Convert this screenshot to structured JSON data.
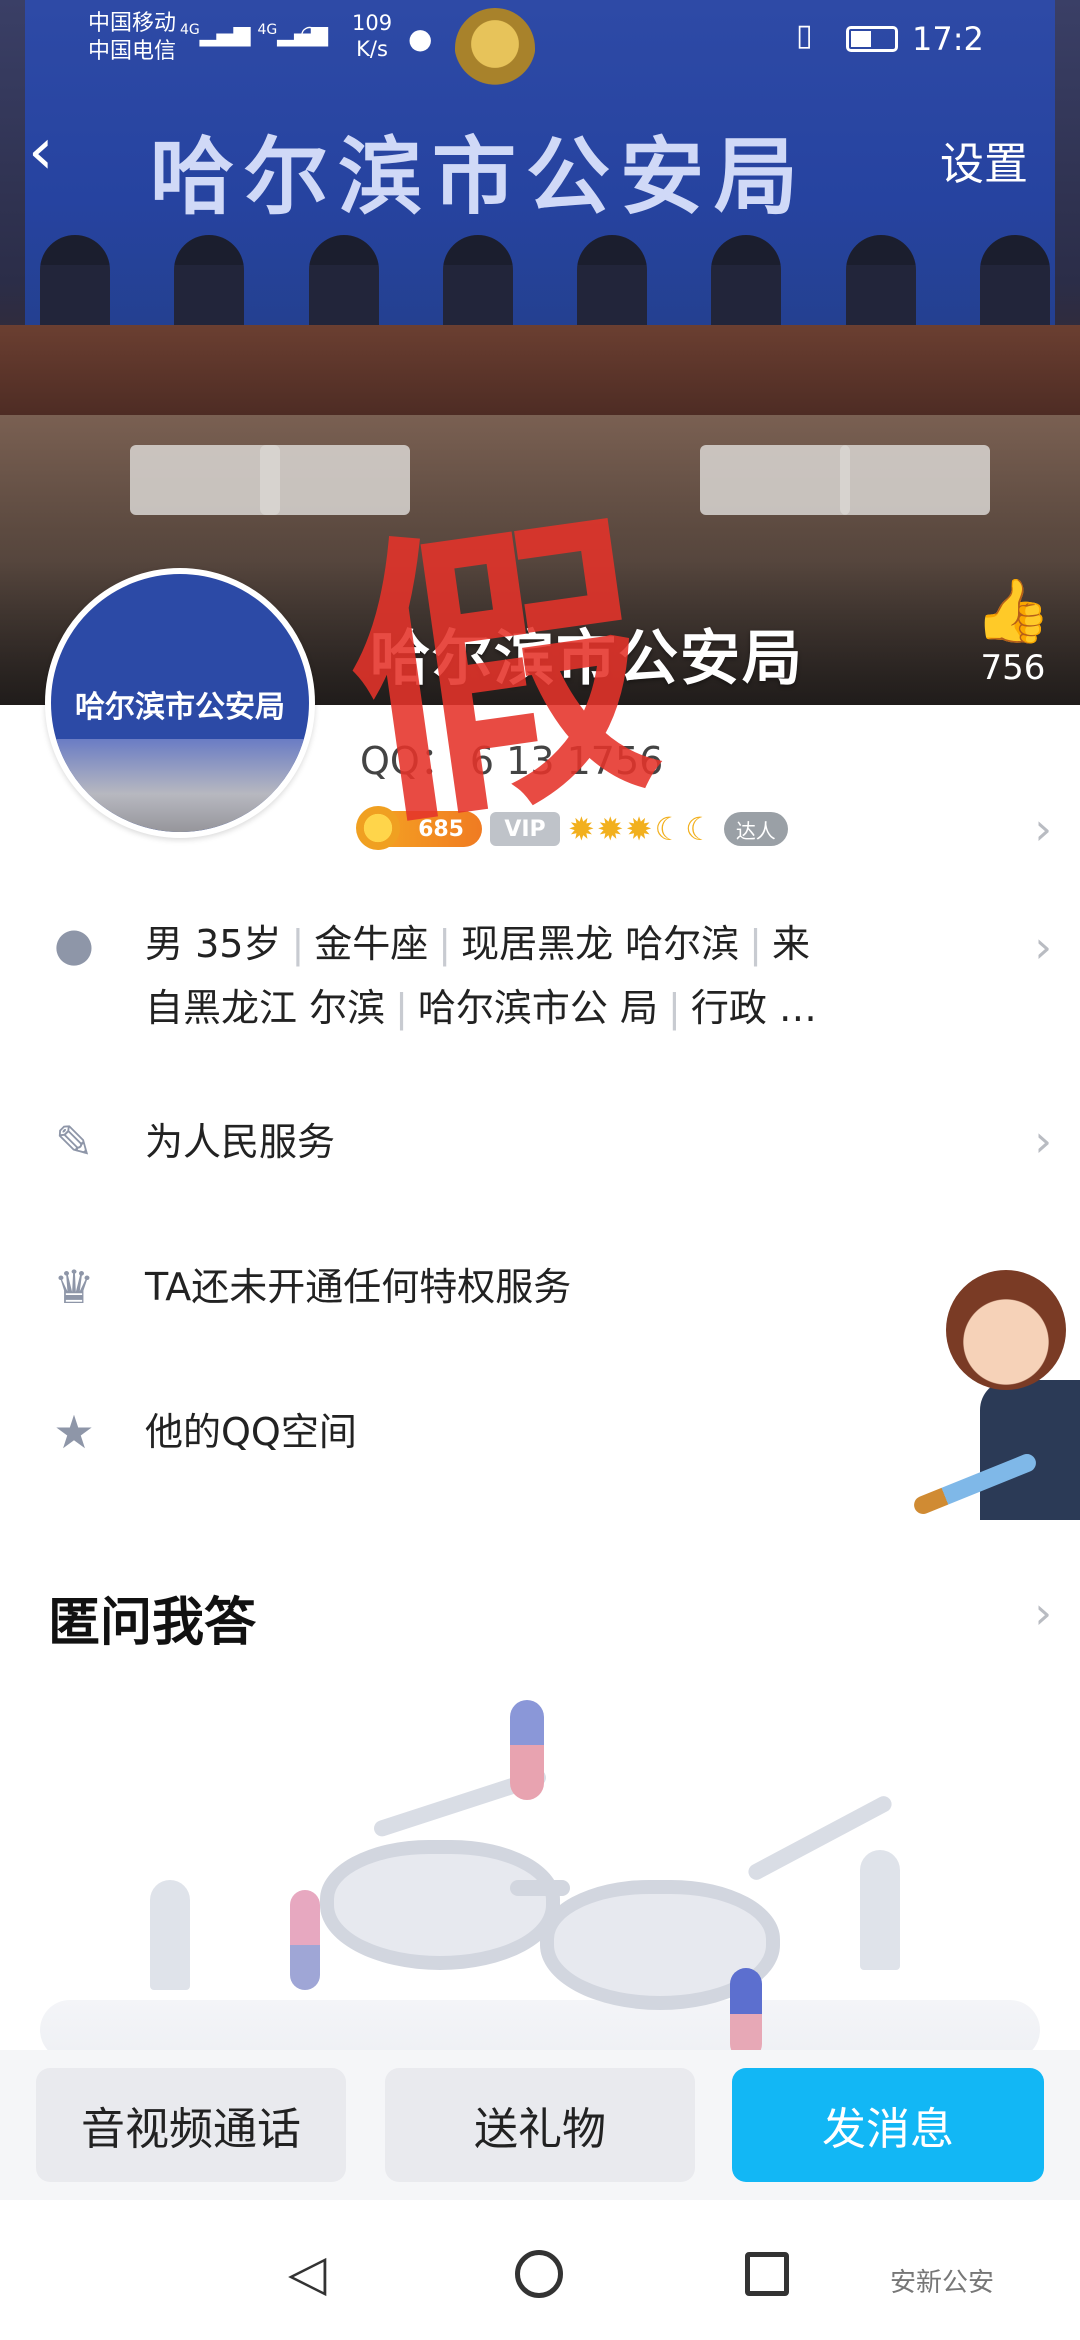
{
  "status_bar": {
    "carrier_1": "中国移动",
    "carrier_2": "中国电信",
    "network_1": "4G",
    "network_2": "4G",
    "speed_value": "109",
    "speed_unit": "K/s",
    "time": "17:2"
  },
  "nav": {
    "back_glyph": "‹",
    "settings_label": "设置"
  },
  "cover": {
    "banner_text": "哈尔滨市公安局"
  },
  "avatar": {
    "text": "哈尔滨市公安局"
  },
  "profile": {
    "name": "哈尔滨市公安局",
    "likes": "756",
    "qq": "QQ：   6 13 1756",
    "level": "685",
    "vip": "VIP",
    "daren": "达人",
    "stamp": "假"
  },
  "info_rows": {
    "basic": "男  35岁 | 金牛座 | 现居黑龙   哈尔滨 | 来自黑龙江  尔滨 | 哈尔滨市公  局 | 行政  …",
    "basic_line1": [
      "男  35岁",
      "金牛座",
      "现居黑龙   哈尔滨",
      "来"
    ],
    "basic_line2": [
      "自黑龙江  尔滨",
      "哈尔滨市公  局",
      "行政  …"
    ],
    "signature": "为人民服务",
    "privilege": "TA还未开通任何特权服务",
    "qzone": "他的QQ空间"
  },
  "section": {
    "title": "匿问我答"
  },
  "actions": {
    "call": "音视频通话",
    "gift": "送礼物",
    "message": "发消息"
  },
  "watermark": "安新公安",
  "colors": {
    "accent": "#12b7f5",
    "stamp": "#e5332a",
    "icon_gray": "#8e96a8"
  },
  "icons": {
    "back": "chevron-left-icon",
    "like": "thumbs-up-icon",
    "person": "person-icon",
    "pen": "pen-icon",
    "crown": "crown-icon",
    "star": "star-icon",
    "chevron": "chevron-right-icon"
  }
}
